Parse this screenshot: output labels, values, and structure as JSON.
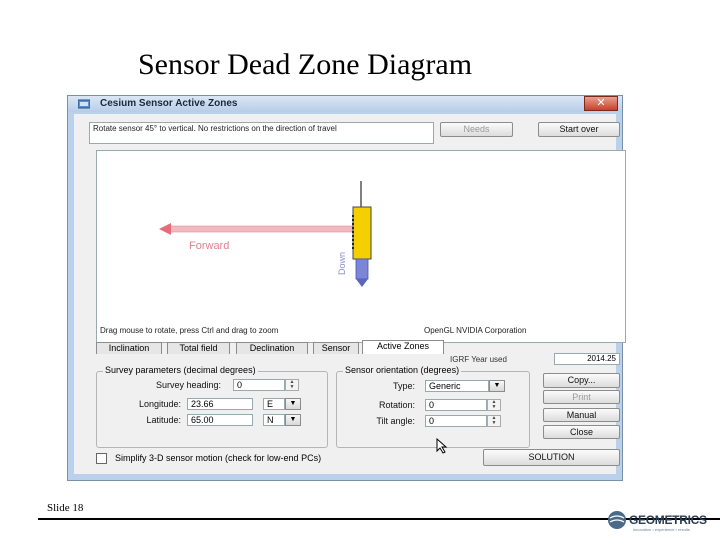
{
  "slide": {
    "title": "Sensor Dead Zone Diagram",
    "slide_number": "Slide 18",
    "logo_text": "GEOMETRICS",
    "logo_subtext": "innovation • experience • results"
  },
  "window": {
    "title": "Cesium Sensor Active Zones",
    "close_glyph": "✕",
    "info_text": "Rotate sensor 45° to vertical. No restrictions on the direction of travel",
    "buttons": {
      "needs": "Needs",
      "start_over": "Start over"
    },
    "view": {
      "forward_label": "Forward",
      "down_label": "Down",
      "status_left": "Drag mouse to rotate, press Ctrl and drag to zoom",
      "status_right": "OpenGL NVIDIA Corporation"
    },
    "tabs": [
      "Inclination",
      "Total field",
      "Declination",
      "Sensor",
      "Active Zones"
    ],
    "active_tab": "Active Zones",
    "date_label": "IGRF Year used",
    "date_value": "2014.25",
    "survey_parameters": {
      "title": "Survey parameters (decimal degrees)",
      "heading_label": "Survey heading:",
      "heading_value": "0",
      "longitude_label": "Longitude:",
      "longitude_value": "23.66",
      "longitude_dir": "E",
      "latitude_label": "Latitude:",
      "latitude_value": "65.00",
      "latitude_dir": "N"
    },
    "sensor_orientation": {
      "title": "Sensor orientation (degrees)",
      "type_label": "Type:",
      "type_value": "Generic",
      "rotation_label": "Rotation:",
      "rotation_value": "0",
      "tilt_label": "Tilt angle:",
      "tilt_value": "0"
    },
    "side_buttons": {
      "copy": "Copy...",
      "print": "Print",
      "manual": "Manual",
      "close": "Close"
    },
    "simplify_label": "Simplify 3-D sensor motion (check for low-end PCs)",
    "solution_button": "SOLUTION"
  },
  "colors": {
    "forward_arrow": "#f2b8c0",
    "sensor_body": "#f5d000",
    "sensor_tip": "#7c86d6",
    "window_frame": "#b9d1ea"
  }
}
